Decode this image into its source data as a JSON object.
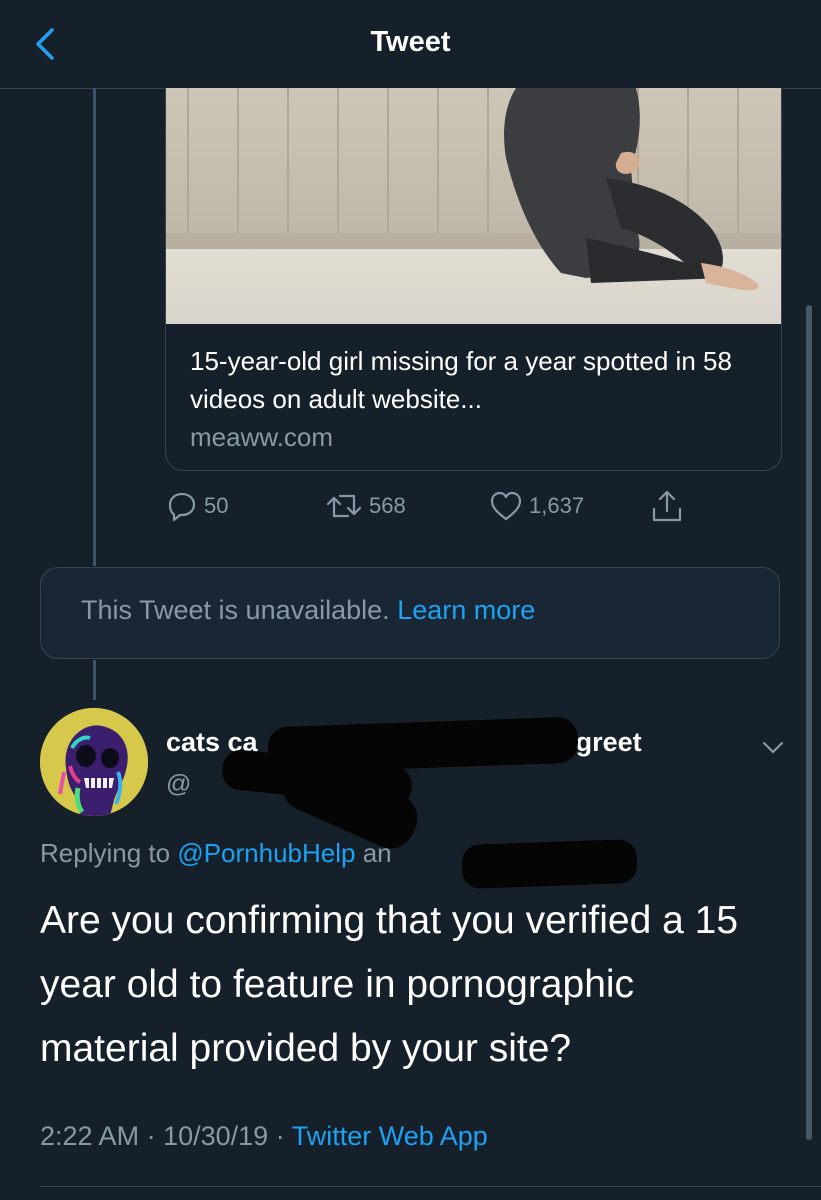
{
  "header": {
    "title": "Tweet"
  },
  "card": {
    "title": "15-year-old girl missing for a year spotted in 58 videos on adult website...",
    "domain": "meaww.com"
  },
  "actions": {
    "replies": "50",
    "retweets": "568",
    "likes": "1,637"
  },
  "unavailable": {
    "message": "This Tweet is unavailable.",
    "link": "Learn more"
  },
  "reply_tweet": {
    "display_name_prefix": "cats ca",
    "display_name_suffix": "as a greet",
    "handle_prefix": "@",
    "replying_prefix": "Replying to",
    "mention": "@PornhubHelp",
    "and_text": "an",
    "text": "Are you confirming that you verified a 15 year old to feature in pornographic material provided by your site?",
    "time": "2:22 AM",
    "date": "10/30/19",
    "source": "Twitter Web App"
  },
  "colors": {
    "background": "#15202b",
    "accent": "#1da1f2",
    "secondary_text": "#8899a6",
    "border": "#38444d"
  }
}
